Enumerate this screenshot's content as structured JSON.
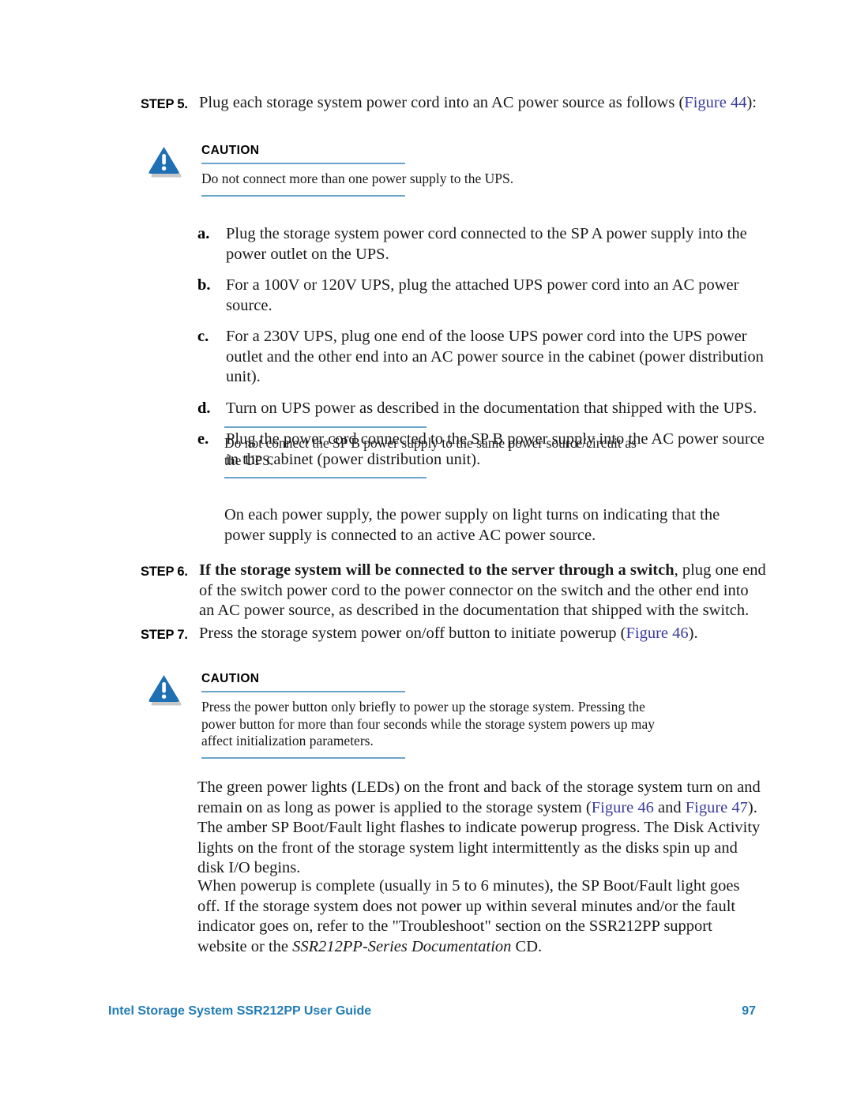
{
  "document": {
    "title": "Intel Storage System SSR212PP User Guide",
    "page_number": "97",
    "footer_color": "#1f7bb6",
    "link_color": "#3b3b9e",
    "rule_color": "#6ba4c9",
    "caution_icon_color": "#1f6fb5"
  },
  "step5": {
    "label": "STEP 5.",
    "text_before": "Plug each storage system power cord into an AC power source as follows (",
    "figure_link": "Figure 44",
    "text_after": "):"
  },
  "caution1": {
    "icon": "caution-triangle-icon",
    "title": "CAUTION",
    "text": "Do not connect more than one power supply to the UPS."
  },
  "sub_list": [
    {
      "marker": "a.",
      "text": "Plug the storage system power cord connected to the SP A power supply into the power outlet on the UPS."
    },
    {
      "marker": "b.",
      "text": "For a 100V or 120V UPS, plug the attached UPS power cord into an AC power source."
    },
    {
      "marker": "c.",
      "text": "For a 230V UPS, plug one end of the loose UPS power cord into the UPS power outlet and the other end into an AC power source in the cabinet (power distribution unit)."
    },
    {
      "marker": "d.",
      "text": "Turn on UPS power as described in the documentation that shipped with the UPS."
    },
    {
      "marker": "e.",
      "text": "Plug the power cord connected to the SP B power supply into the AC power source in the cabinet (power distribution unit)."
    }
  ],
  "note1": {
    "text": "Do not connect the SP B power supply to the same power source/circuit as the UPS."
  },
  "para1": {
    "text": "On each power supply, the power supply on light turns on indicating that the power supply is connected to an active AC power source."
  },
  "step6": {
    "label": "STEP 6.",
    "bold_text": "If the storage system will be connected to the server through a switch",
    "rest_text": ", plug one end of the switch power cord to the power connector on the switch and the other end into an AC power source, as described in the documentation that shipped with the switch."
  },
  "step7": {
    "label": "STEP 7.",
    "text_before": "Press the storage system power on/off button to initiate powerup (",
    "figure_link": "Figure 46",
    "text_after": ")."
  },
  "caution2": {
    "icon": "caution-triangle-icon",
    "title": "CAUTION",
    "text": "Press the power button only briefly to power up the storage system. Pressing the power button for more than four seconds while the storage system powers up may affect initialization parameters."
  },
  "para2": {
    "part1": "The green power lights (LEDs) on the front and back of the storage system turn on and remain on as long as power is applied to the storage system (",
    "figure_link_1": "Figure 46",
    "part2": " and ",
    "figure_link_2": "Figure 47",
    "part3": "). The amber SP Boot/Fault light flashes to indicate powerup progress. The Disk Activity lights on the front of the storage system light intermittently as the disks spin up and disk I/O begins."
  },
  "para3": {
    "part1": "When powerup is complete (usually in 5 to 6 minutes), the SP Boot/Fault light goes off. If the storage system does not power up within several minutes and/or the fault indicator goes on, refer to the \"Troubleshoot\" section on the SSR212PP support website or the ",
    "italic_text": "SSR212PP-Series Documentation",
    "part2": " CD."
  }
}
